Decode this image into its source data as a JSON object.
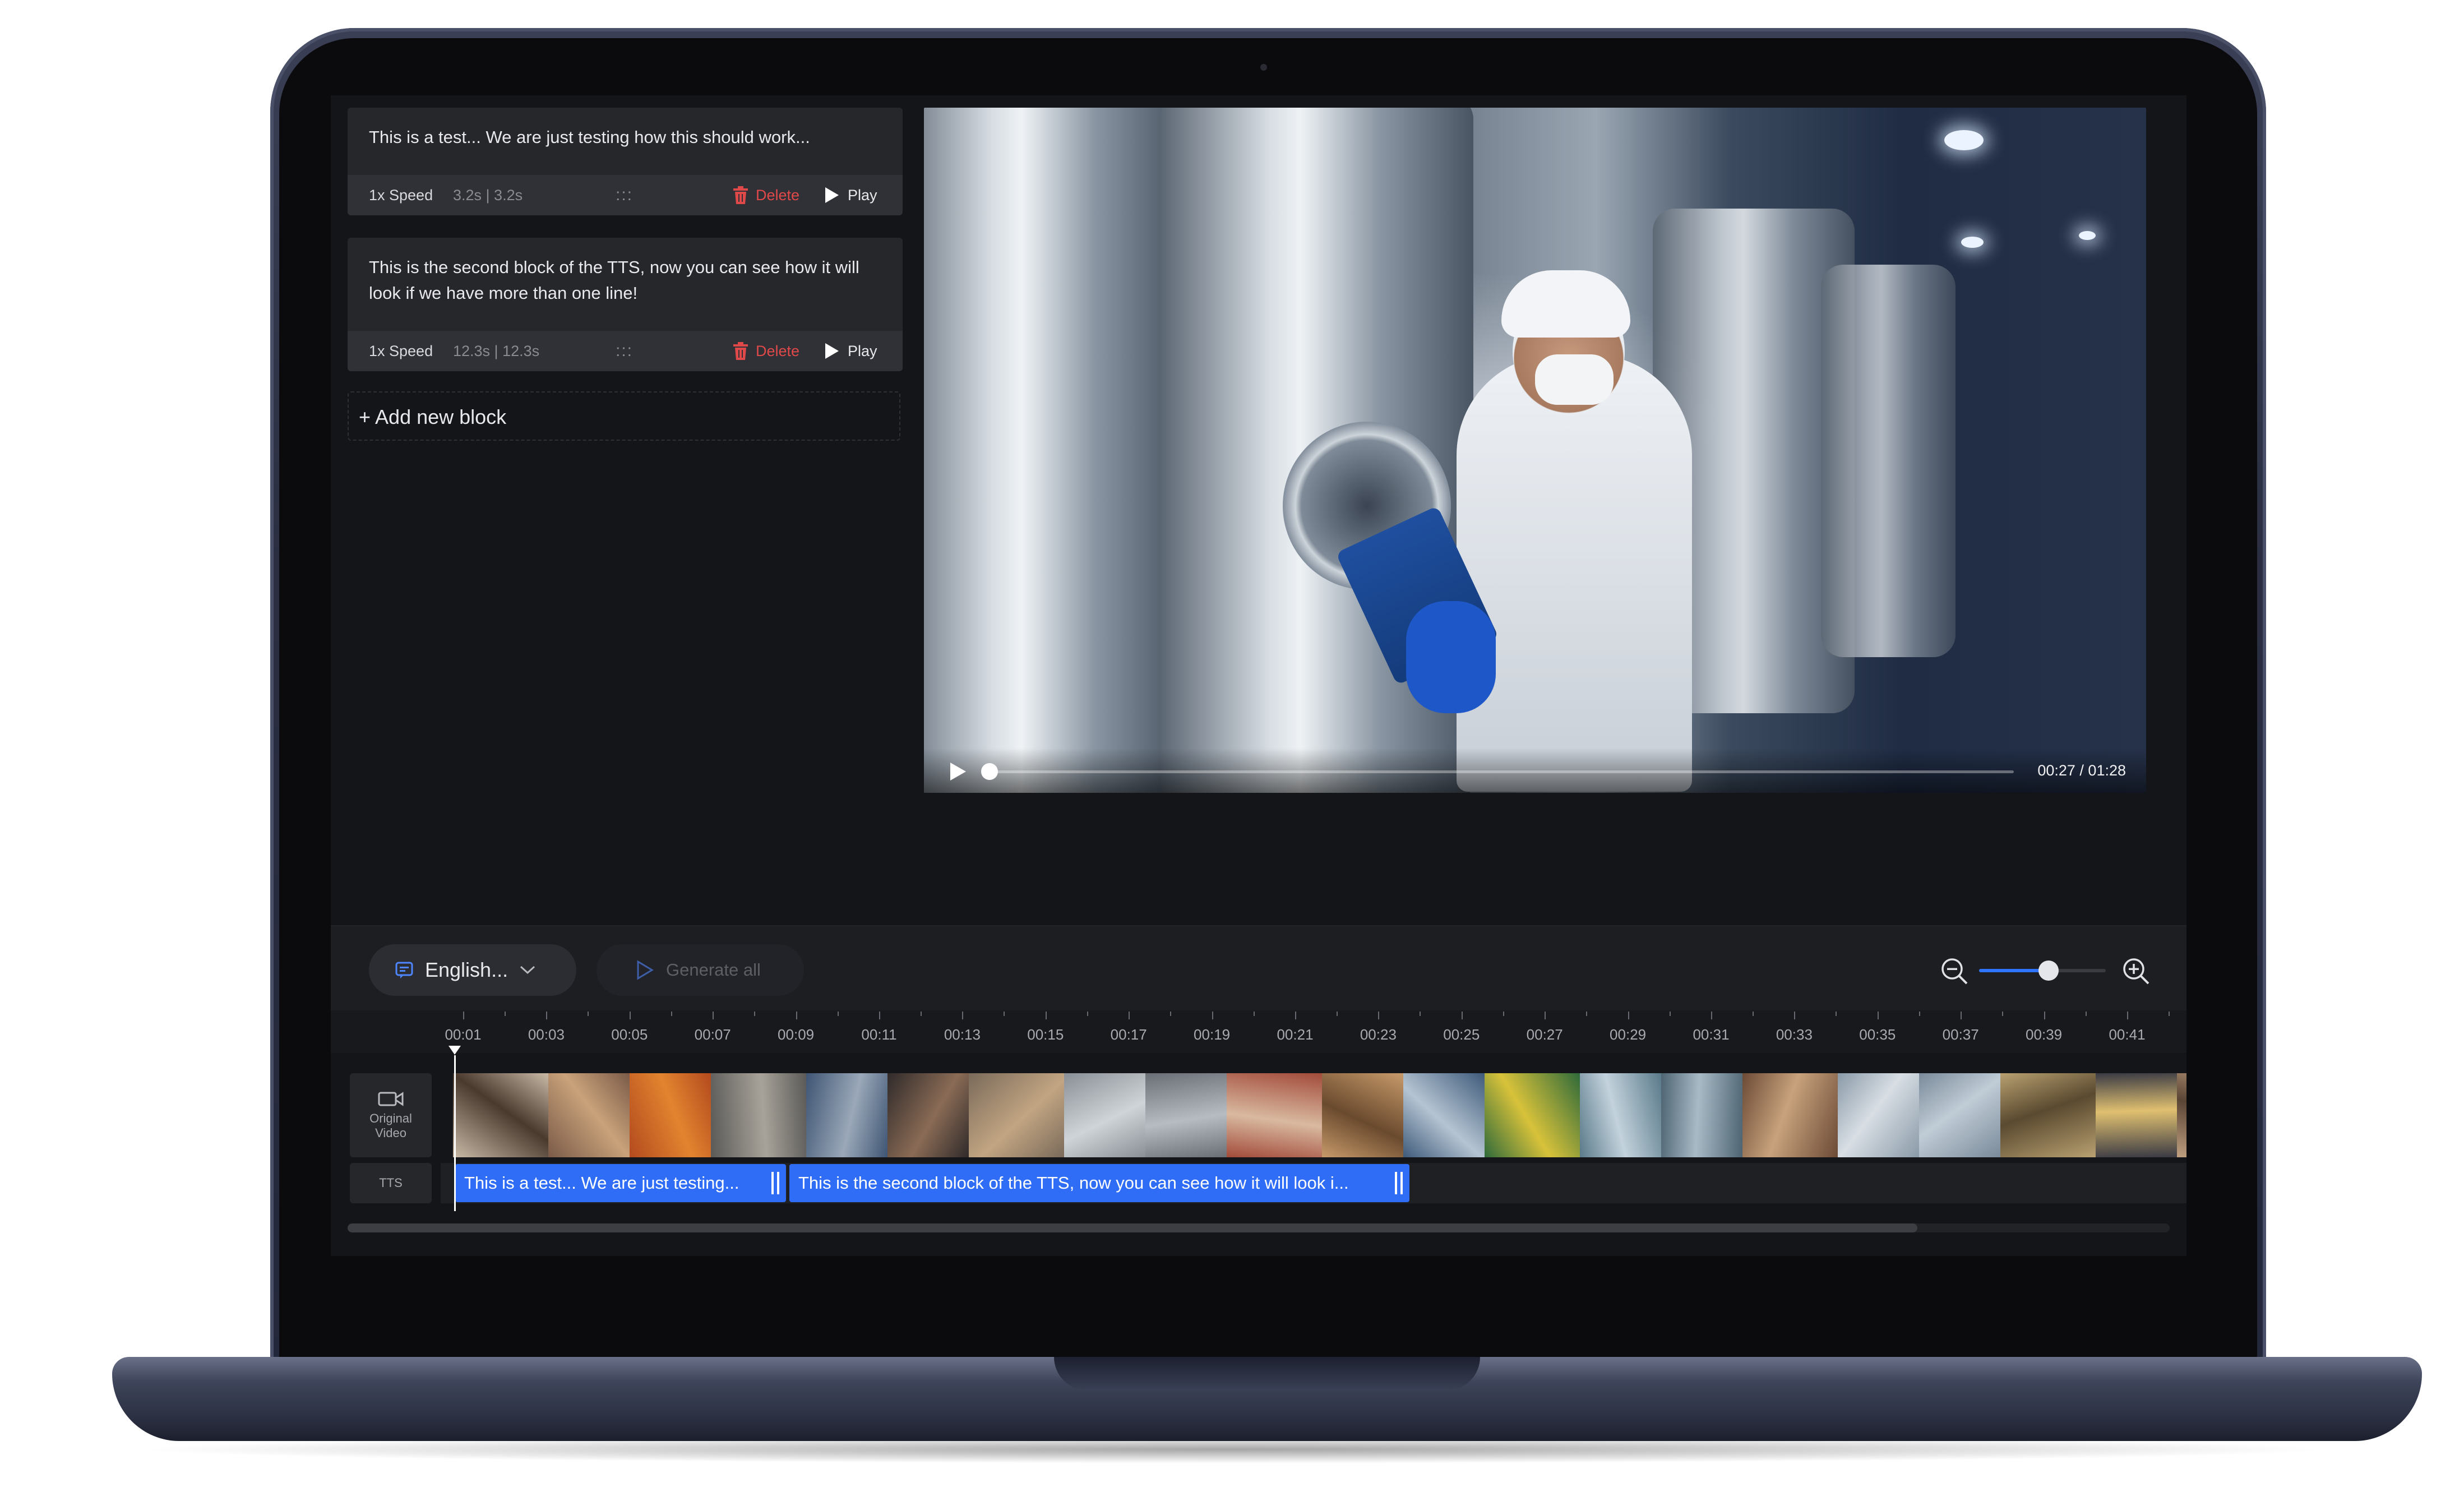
{
  "blocks": [
    {
      "text": "This is a test... We are just testing how this should work...",
      "speed": "1x Speed",
      "duration": "3.2s | 3.2s",
      "drag": ":::",
      "delete_label": "Delete",
      "play_label": "Play"
    },
    {
      "text": "This is the second block of the TTS, now you can see how it will look if we have more than one line!",
      "speed": "1x Speed",
      "duration": "12.3s | 12.3s",
      "drag": ":::",
      "delete_label": "Delete",
      "play_label": "Play"
    }
  ],
  "add_block_label": "+ Add new block",
  "video": {
    "time": "00:27 / 01:28",
    "progress": 0.003
  },
  "toolbar": {
    "language": "English...",
    "generate_all": "Generate all",
    "zoom_level": 0.55
  },
  "timeline": {
    "ticks": [
      "00:01",
      "00:03",
      "00:05",
      "00:07",
      "00:09",
      "00:11",
      "00:13",
      "00:15",
      "00:17",
      "00:19",
      "00:21",
      "00:23",
      "00:25",
      "00:27",
      "00:29",
      "00:31",
      "00:33",
      "00:35",
      "00:37",
      "00:39",
      "00:41"
    ],
    "track_original_label": "Original Video",
    "track_tts_label": "TTS",
    "tts_clips": [
      "This is a test... We are just testing...",
      "This is the second block of the TTS, now you can see how it will look i..."
    ]
  },
  "colors": {
    "accent": "#2f6df6",
    "delete": "#e0494a",
    "panel": "#26272b",
    "background": "#141518"
  }
}
